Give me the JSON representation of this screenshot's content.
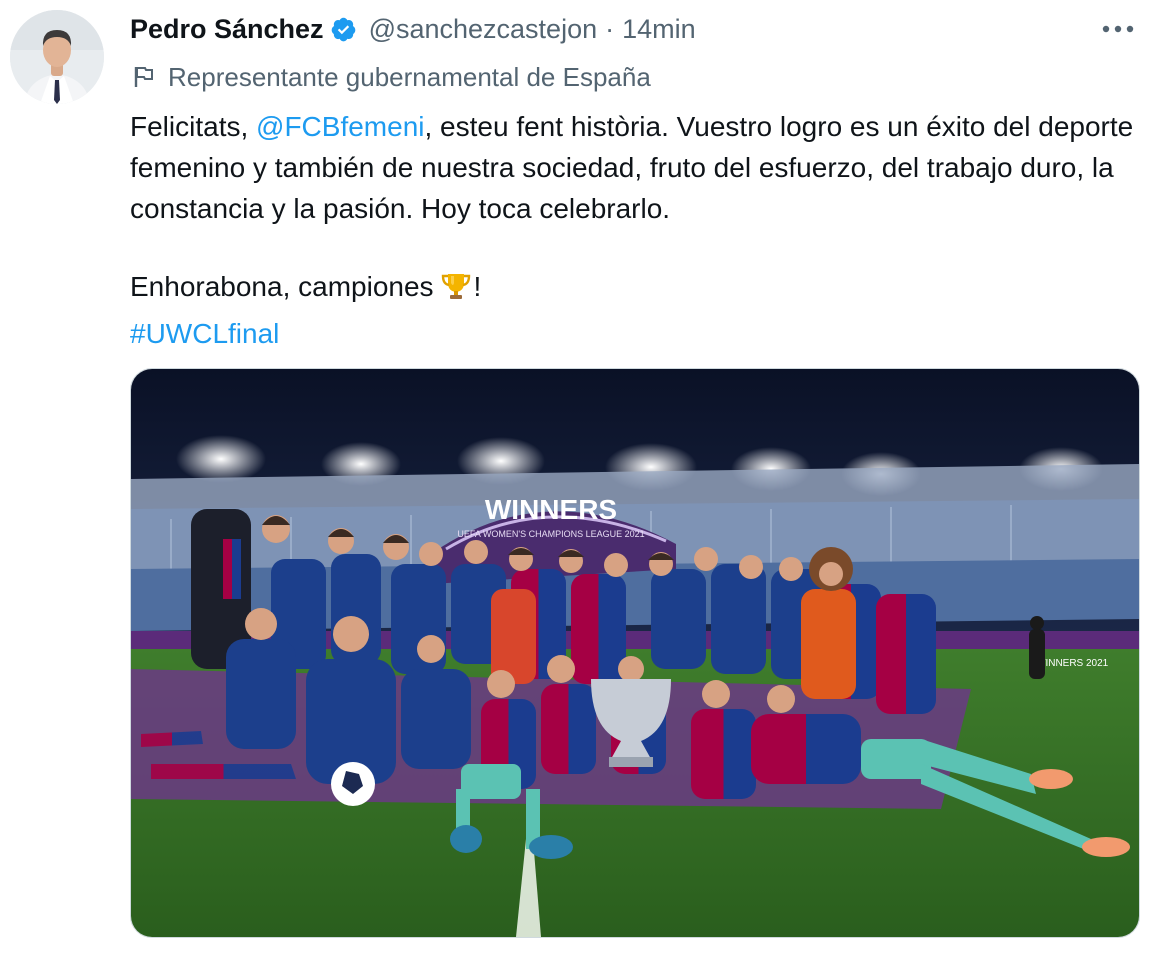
{
  "author": {
    "name": "Pedro Sánchez",
    "handle": "@sanchezcastejon",
    "separator": "·",
    "time": "14min",
    "verified": true,
    "label": "Representante gubernamental de España"
  },
  "tweet": {
    "part1": "Felicitats, ",
    "mention": "@FCBfemeni",
    "part2": ", esteu fent història. Vuestro logro es un éxito del deporte femenino y también de nuestra sociedad, fruto del esfuerzo, del trabajo duro, la constancia y la pasión. Hoy toca celebrarlo.",
    "line2_before": "Enhorabona, campiones",
    "line2_emoji": "trophy-emoji",
    "line2_after": "!",
    "hashtag": "#UWCLfinal"
  },
  "media": {
    "type": "photo",
    "banner_text": "WINNERS",
    "banner_subtext": "UEFA WOMEN'S CHAMPIONS LEAGUE 2021",
    "board_text": "WINNERS 2021"
  },
  "icons": {
    "verified": "verified-badge-icon",
    "more": "more-options-icon",
    "label": "flag-icon"
  },
  "colors": {
    "link": "#1d9bf0",
    "secondary_text": "#536471",
    "verified": "#1d9bf0"
  }
}
